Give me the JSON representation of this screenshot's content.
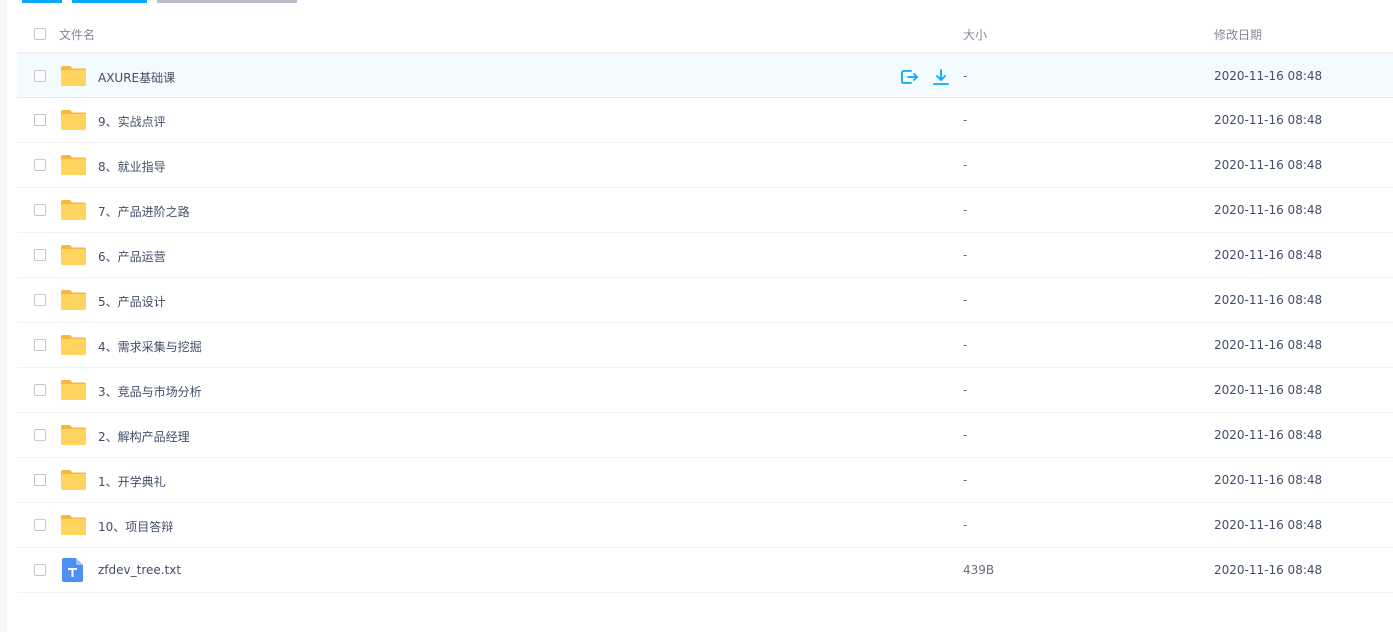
{
  "header": {
    "col_name": "文件名",
    "col_size": "大小",
    "col_date": "修改日期"
  },
  "colors": {
    "accent": "#06a7ff",
    "folder": "#ffd15a",
    "txt_icon": "#4d8ff2"
  },
  "files": [
    {
      "name": "AXURE基础课",
      "size": "-",
      "date": "2020-11-16 08:48",
      "type": "folder",
      "hover": true
    },
    {
      "name": "9、实战点评",
      "size": "-",
      "date": "2020-11-16 08:48",
      "type": "folder"
    },
    {
      "name": "8、就业指导",
      "size": "-",
      "date": "2020-11-16 08:48",
      "type": "folder"
    },
    {
      "name": "7、产品进阶之路",
      "size": "-",
      "date": "2020-11-16 08:48",
      "type": "folder"
    },
    {
      "name": "6、产品运营",
      "size": "-",
      "date": "2020-11-16 08:48",
      "type": "folder"
    },
    {
      "name": "5、产品设计",
      "size": "-",
      "date": "2020-11-16 08:48",
      "type": "folder"
    },
    {
      "name": "4、需求采集与挖掘",
      "size": "-",
      "date": "2020-11-16 08:48",
      "type": "folder"
    },
    {
      "name": "3、竞品与市场分析",
      "size": "-",
      "date": "2020-11-16 08:48",
      "type": "folder"
    },
    {
      "name": "2、解构产品经理",
      "size": "-",
      "date": "2020-11-16 08:48",
      "type": "folder"
    },
    {
      "name": "1、开学典礼",
      "size": "-",
      "date": "2020-11-16 08:48",
      "type": "folder"
    },
    {
      "name": "10、项目答辩",
      "size": "-",
      "date": "2020-11-16 08:48",
      "type": "folder"
    },
    {
      "name": "zfdev_tree.txt",
      "size": "439B",
      "date": "2020-11-16 08:48",
      "type": "txt"
    }
  ]
}
